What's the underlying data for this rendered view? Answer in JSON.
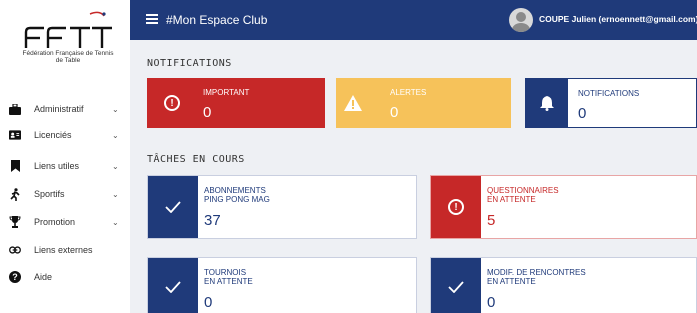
{
  "brand": {
    "logo_text": "FFTT",
    "subtitle": "Fédération Française de Tennis de Table"
  },
  "sidebar": {
    "items": [
      {
        "label": "Administratif",
        "icon": "briefcase-icon",
        "has_chevron": true
      },
      {
        "label": "Licenciés",
        "icon": "id-card-icon",
        "has_chevron": true
      },
      {
        "label": "Liens utiles",
        "icon": "bookmark-icon",
        "has_chevron": true
      },
      {
        "label": "Sportifs",
        "icon": "running-icon",
        "has_chevron": true
      },
      {
        "label": "Promotion",
        "icon": "trophy-icon",
        "has_chevron": true
      },
      {
        "label": "Liens externes",
        "icon": "link-icon",
        "has_chevron": false
      },
      {
        "label": "Aide",
        "icon": "help-icon",
        "has_chevron": false
      }
    ]
  },
  "header": {
    "title": "#Mon Espace Club",
    "user": "COUPE Julien (ernoennett@gmail.com)"
  },
  "notifications": {
    "title": "NOTIFICATIONS",
    "cards": [
      {
        "label": "IMPORTANT",
        "value": "0",
        "color": "#c62828",
        "icon": "alert-circle-icon"
      },
      {
        "label": "ALERTES",
        "value": "0",
        "color": "#f6c25a",
        "icon": "warning-icon"
      },
      {
        "label": "NOTIFICATIONS",
        "value": "0",
        "color": "#1f3a7a",
        "icon": "bell-icon"
      }
    ]
  },
  "tasks": {
    "title": "TÂCHES EN COURS",
    "cards": [
      {
        "label_line1": "ABONNEMENTS",
        "label_line2": "PING PONG MAG",
        "value": "37",
        "color": "#1f3a7a",
        "icon": "check-icon"
      },
      {
        "label_line1": "QUESTIONNAIRES",
        "label_line2": "EN ATTENTE",
        "value": "5",
        "color": "#c62828",
        "icon": "alert-circle-icon"
      },
      {
        "label_line1": "TOURNOIS",
        "label_line2": "EN ATTENTE",
        "value": "0",
        "color": "#1f3a7a",
        "icon": "check-icon"
      },
      {
        "label_line1": "MODIF. DE RENCONTRES",
        "label_line2": "EN ATTENTE",
        "value": "0",
        "color": "#1f3a7a",
        "icon": "check-icon"
      }
    ]
  }
}
